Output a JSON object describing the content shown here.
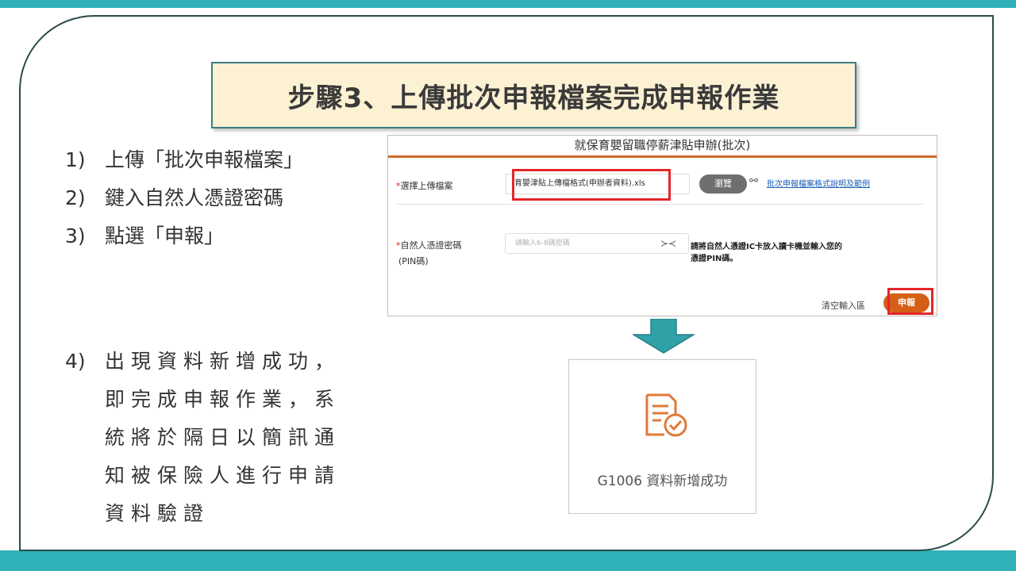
{
  "slide": {
    "title": "步驟3、上傳批次申報檔案完成申報作業",
    "steps": [
      {
        "num": "1)",
        "text": "上傳「批次申報檔案」"
      },
      {
        "num": "2)",
        "text": "鍵入自然人憑證密碼"
      },
      {
        "num": "3)",
        "text": "點選「申報」"
      }
    ],
    "step4": {
      "num": "4)",
      "text": "出現資料新增成功，即完成申報作業，系統將於隔日以簡訊通知被保險人進行申請資料驗證"
    }
  },
  "form": {
    "title": "就保育嬰留職停薪津貼申辦(批次)",
    "file_label": "選擇上傳檔案",
    "file_value": "育嬰津貼上傳檔格式(申辦者資料).xls",
    "browse_label": "瀏覽",
    "doc_link": "批次申報檔案格式說明及範例",
    "pin_label": "自然人憑證密碼",
    "pin_label2": "(PIN碼)",
    "pin_placeholder": "請輸入6-8碼密碼",
    "pin_note": "請將自然人憑證IC卡放入讀卡機並輸入您的憑證PIN碼。",
    "clear_label": "清空輸入區",
    "submit_label": "申報",
    "required_mark": "*"
  },
  "result": {
    "message": "G1006 資料新增成功"
  },
  "colors": {
    "accent_teal": "#2fb1b7",
    "title_bg": "#fdf1d3",
    "orange": "#d55f17",
    "highlight_red": "#e4262a"
  }
}
